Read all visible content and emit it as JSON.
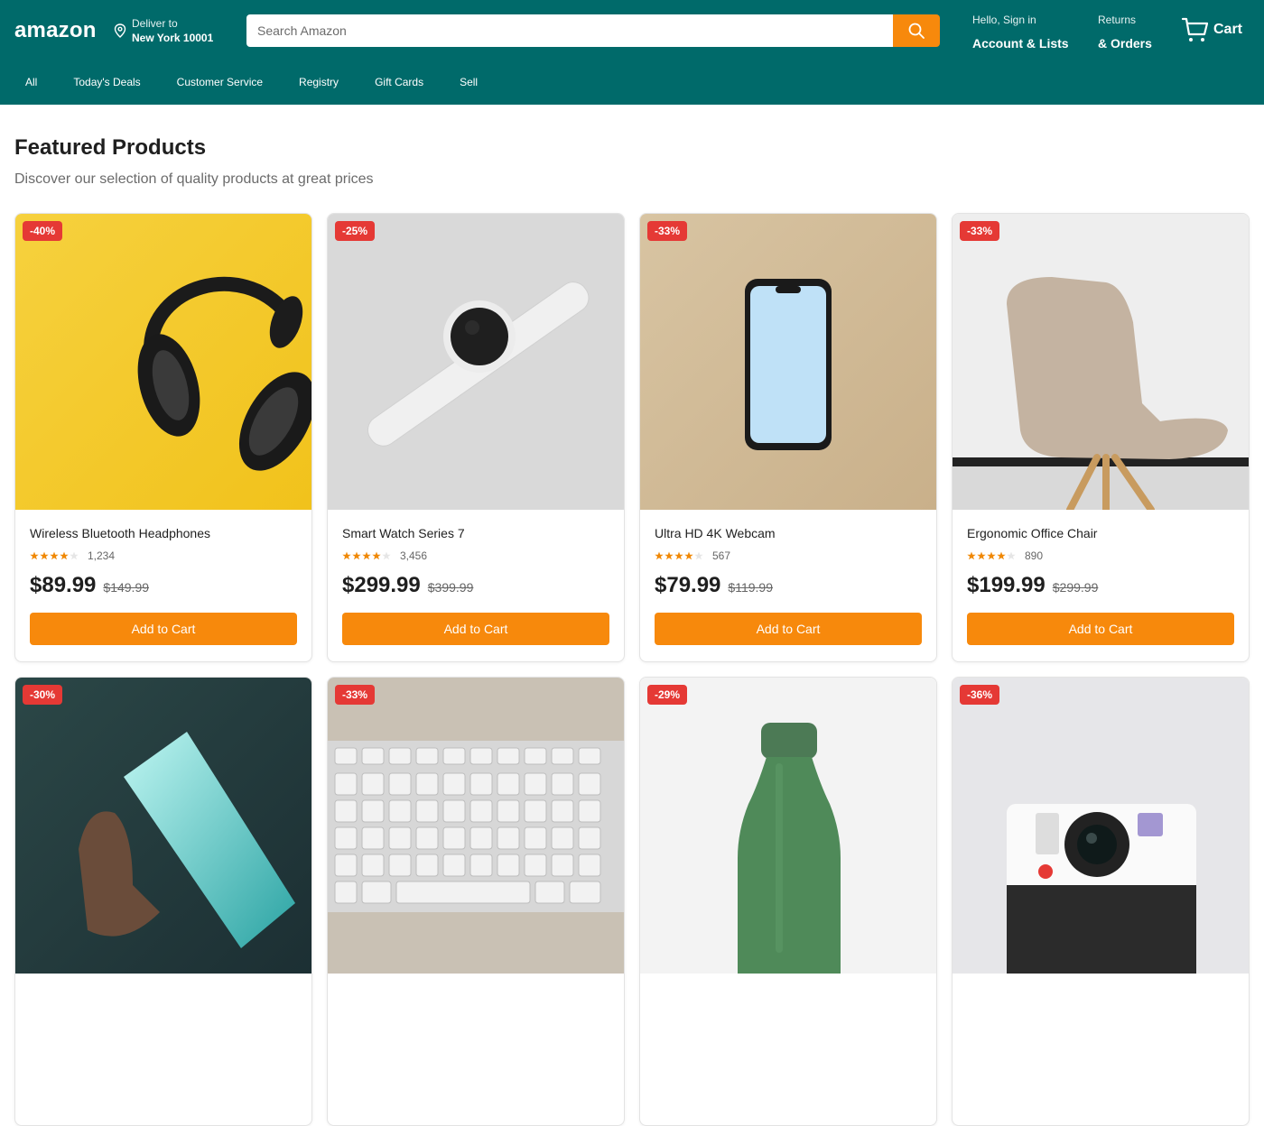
{
  "header": {
    "logo": "amazon",
    "deliver_line1": "Deliver to",
    "deliver_line2": "New York 10001",
    "search_placeholder": "Search Amazon",
    "account_small": "Hello, Sign in",
    "account_big": "Account & Lists",
    "orders_small": "Returns",
    "orders_big": "& Orders",
    "cart_label": "Cart"
  },
  "nav": [
    "All",
    "Today's Deals",
    "Customer Service",
    "Registry",
    "Gift Cards",
    "Sell"
  ],
  "main": {
    "title": "Featured Products",
    "subtitle": "Discover our selection of quality products at great prices"
  },
  "products": [
    {
      "name": "Wireless Bluetooth Headphones",
      "badge": "-40%",
      "reviews": "1,234",
      "rating": 4.5,
      "price": "$89.99",
      "old_price": "$149.99",
      "button": "Add to Cart"
    },
    {
      "name": "Smart Watch Series 7",
      "badge": "-25%",
      "reviews": "3,456",
      "rating": 4.5,
      "price": "$299.99",
      "old_price": "$399.99",
      "button": "Add to Cart"
    },
    {
      "name": "Ultra HD 4K Webcam",
      "badge": "-33%",
      "reviews": "567",
      "rating": 4.5,
      "price": "$79.99",
      "old_price": "$119.99",
      "button": "Add to Cart"
    },
    {
      "name": "Ergonomic Office Chair",
      "badge": "-33%",
      "reviews": "890",
      "rating": 4.5,
      "price": "$199.99",
      "old_price": "$299.99",
      "button": "Add to Cart"
    },
    {
      "name": "",
      "badge": "-30%"
    },
    {
      "name": "",
      "badge": "-33%"
    },
    {
      "name": "",
      "badge": "-29%"
    },
    {
      "name": "",
      "badge": "-36%"
    }
  ],
  "colors": {
    "header_bg": "#006a6a",
    "accent": "#f7890c",
    "badge": "#e53935"
  }
}
